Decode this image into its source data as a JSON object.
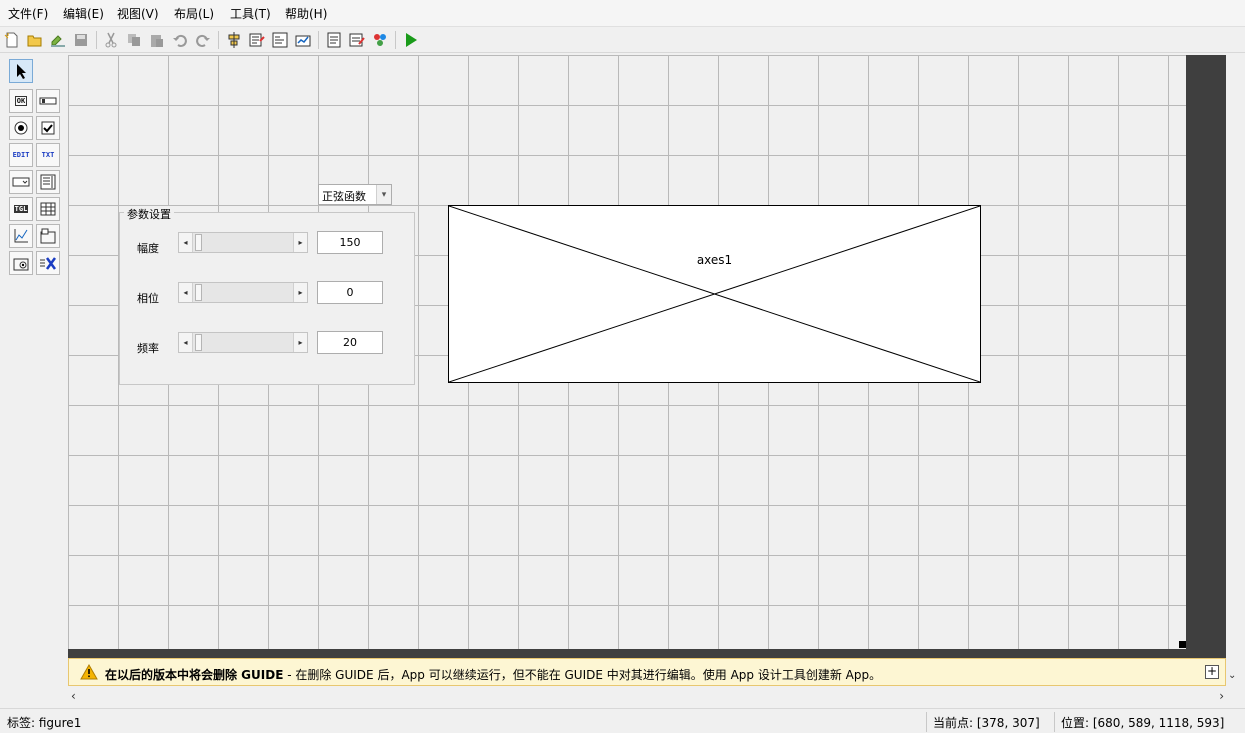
{
  "menu": [
    "文件(F)",
    "编辑(E)",
    "视图(V)",
    "布局(L)",
    "工具(T)",
    "帮助(H)"
  ],
  "toolbar_icons": [
    "new-icon",
    "open-icon",
    "save-as-icon",
    "save-icon",
    "cut-icon",
    "copy-icon",
    "paste-icon",
    "undo-icon",
    "redo-icon",
    "align-icon",
    "menu-editor-icon",
    "tab-order-icon",
    "toolbar-editor-icon",
    "editor-icon",
    "property-inspector-icon",
    "object-browser-icon",
    "run-icon"
  ],
  "palette": {
    "select_icon": "arrow-icon",
    "buttons": [
      "OK",
      "slider",
      "radio",
      "check",
      "EDIT",
      "TXT",
      "popup",
      "listbox",
      "TGL",
      "table",
      "axes",
      "panel",
      "btngroup",
      "activex"
    ]
  },
  "layout": {
    "popup_value": "正弦函数",
    "panel_title": "参数设置",
    "rows": [
      {
        "label": "幅度",
        "value": "150"
      },
      {
        "label": "相位",
        "value": "0"
      },
      {
        "label": "频率",
        "value": "20"
      }
    ],
    "axes_label": "axes1"
  },
  "warning": {
    "bold": "在以后的版本中将会删除 GUIDE",
    "rest": " - 在删除 GUIDE 后，App 可以继续运行，但不能在 GUIDE 中对其进行编辑。使用 App 设计工具创建新 App。",
    "expand": "+"
  },
  "status": {
    "tag": "标签: figure1",
    "current_point": "当前点:  [378, 307]",
    "position": "位置: [680, 589, 1118, 593]"
  },
  "colors": {
    "warning_bg": "#fdf6d3",
    "run_green": "#1a9b1a",
    "grid": "#b9b9b9"
  }
}
